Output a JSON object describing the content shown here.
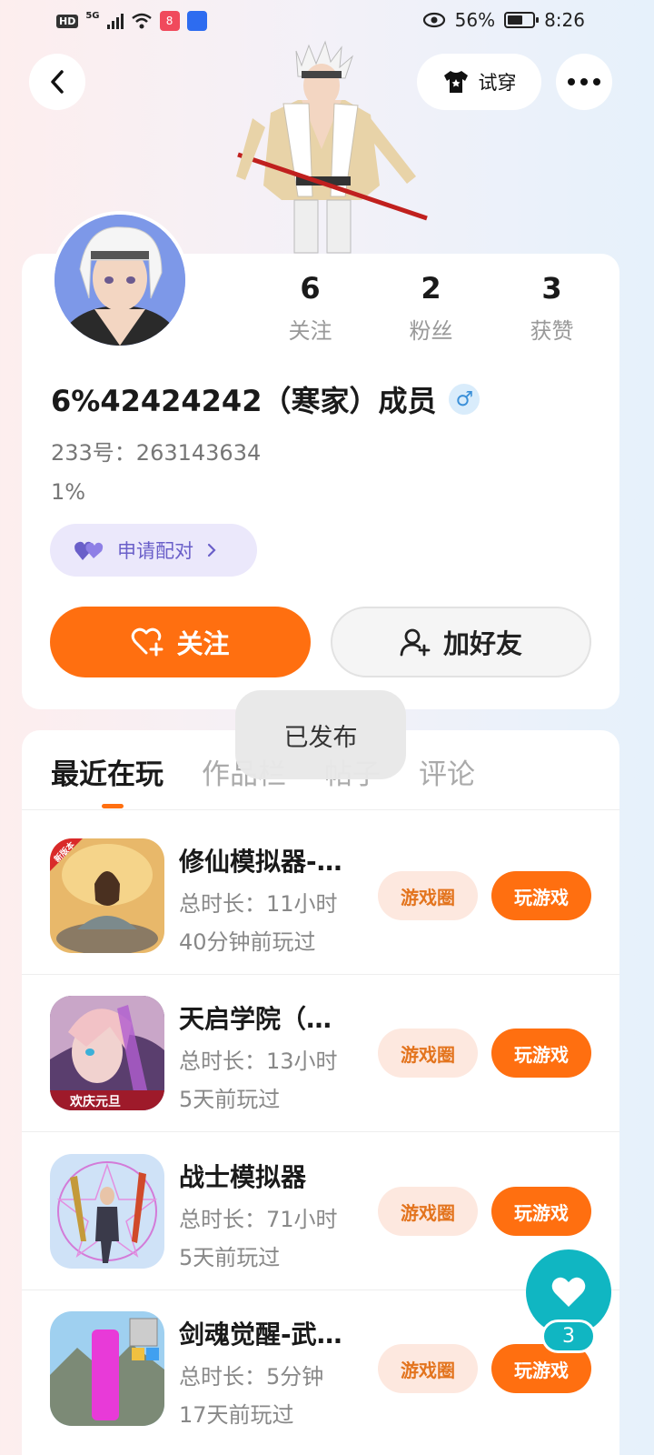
{
  "status_bar": {
    "network": "5G",
    "hd": "HD",
    "app_badge": "8",
    "battery": "56%",
    "time": "8:26"
  },
  "header": {
    "try_on_label": "试穿"
  },
  "profile": {
    "stats": [
      {
        "count": "6",
        "label": "关注"
      },
      {
        "count": "2",
        "label": "粉丝"
      },
      {
        "count": "3",
        "label": "获赞"
      }
    ],
    "nickname": "6%42424242（寒家）成员",
    "gender_symbol": "♂",
    "id_line": "233号：263143634",
    "signature": "1%",
    "pair_label": "申请配对",
    "follow_label": "关注",
    "add_friend_label": "加好友"
  },
  "tabs": [
    {
      "label": "最近在玩"
    },
    {
      "label": "作品栏"
    },
    {
      "label": "帖子"
    },
    {
      "label": "评论"
    }
  ],
  "toast": "已发布",
  "games": [
    {
      "title": "修仙模拟器-…",
      "time": "总时长：11小时",
      "last_played": "40分钟前玩过",
      "circle_label": "游戏圈",
      "play_label": "玩游戏",
      "icon_badge": "新版本"
    },
    {
      "title": "天启学院（…",
      "time": "总时长：13小时",
      "last_played": "5天前玩过",
      "circle_label": "游戏圈",
      "play_label": "玩游戏",
      "icon_badge": "欢庆元旦"
    },
    {
      "title": "战士模拟器",
      "time": "总时长：71小时",
      "last_played": "5天前玩过",
      "circle_label": "游戏圈",
      "play_label": "玩游戏",
      "icon_badge": ""
    },
    {
      "title": "剑魂觉醒-武…",
      "time": "总时长：5分钟",
      "last_played": "17天前玩过",
      "circle_label": "游戏圈",
      "play_label": "玩游戏",
      "icon_badge": ""
    }
  ],
  "like_fab": {
    "count": "3"
  },
  "colors": {
    "accent": "#ff6f10",
    "teal": "#10b6c2",
    "pair": "#6a5fc9"
  }
}
